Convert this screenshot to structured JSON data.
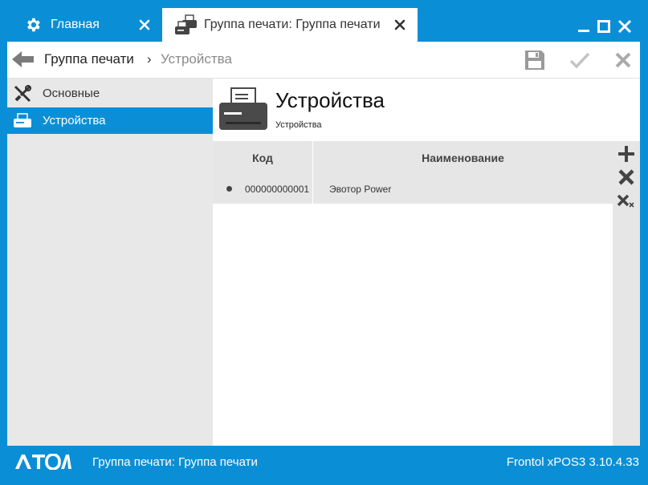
{
  "tabs": [
    {
      "label": "Главная",
      "icon": "gear-icon"
    },
    {
      "label": "Группа печати: Группа печати",
      "icon": "printer-group-icon"
    }
  ],
  "toolbar": {
    "breadcrumb_parent": "Группа печати",
    "breadcrumb_sep": "›",
    "breadcrumb_current": "Устройства"
  },
  "sidebar": {
    "items": [
      {
        "label": "Основные",
        "icon": "tools-icon",
        "active": false
      },
      {
        "label": "Устройства",
        "icon": "printer-icon",
        "active": true
      }
    ]
  },
  "main": {
    "title": "Устройства",
    "subtitle": "Устройства",
    "columns": [
      "Код",
      "Наименование"
    ],
    "rows": [
      {
        "code": "000000000001",
        "name": "Эвотор Power"
      }
    ]
  },
  "status": {
    "logo": "АТОЛ",
    "text": "Группа печати: Группа печати",
    "version": "Frontol xPOS3 3.10.4.33"
  },
  "colors": {
    "accent": "#0a8fd6",
    "sidebar_bg": "#e8e8e8",
    "grid_bg": "#e6e6e6"
  }
}
